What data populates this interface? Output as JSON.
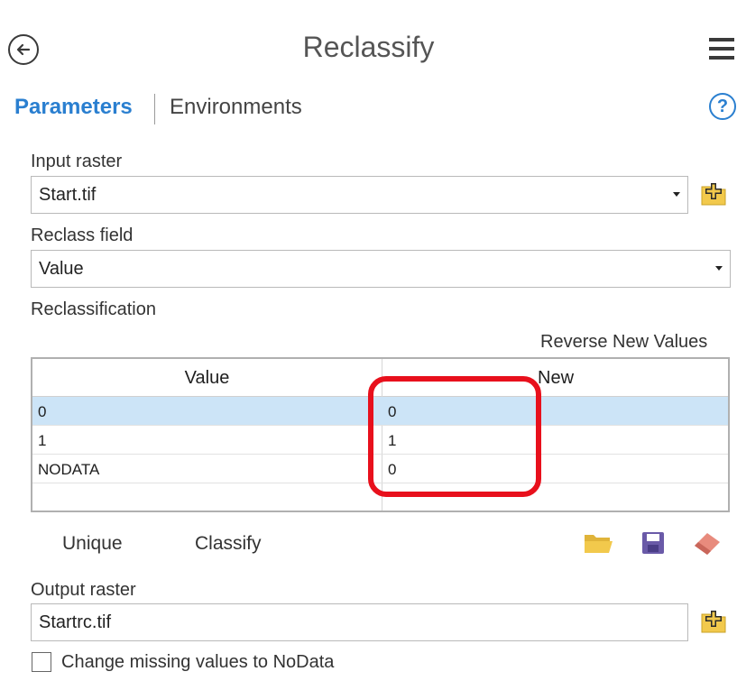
{
  "header": {
    "title": "Reclassify"
  },
  "tabs": [
    {
      "label": "Parameters",
      "active": true
    },
    {
      "label": "Environments",
      "active": false
    }
  ],
  "help_symbol": "?",
  "input_raster": {
    "label": "Input raster",
    "value": "Start.tif"
  },
  "reclass_field": {
    "label": "Reclass field",
    "value": "Value"
  },
  "reclassification": {
    "label": "Reclassification",
    "reverse_label": "Reverse New Values",
    "columns": [
      "Value",
      "New"
    ],
    "rows": [
      {
        "value": "0",
        "new": "0",
        "selected": true
      },
      {
        "value": "1",
        "new": "1",
        "selected": false
      },
      {
        "value": "NODATA",
        "new": "0",
        "selected": false
      }
    ],
    "unique_label": "Unique",
    "classify_label": "Classify"
  },
  "output_raster": {
    "label": "Output raster",
    "value": "Startrc.tif"
  },
  "missing_values": {
    "label": "Change missing values to NoData",
    "checked": false
  },
  "colors": {
    "accent": "#2a7fd0",
    "selected_row": "#cce4f7",
    "highlight": "#e8101c",
    "folder": "#f2c94c",
    "save": "#6a5aa8",
    "eraser": "#e88b7d"
  },
  "icons": [
    "back-arrow-icon",
    "hamburger-menu-icon",
    "help-icon",
    "add-folder-icon",
    "open-folder-icon",
    "save-icon",
    "eraser-icon",
    "dropdown-arrow-icon"
  ]
}
